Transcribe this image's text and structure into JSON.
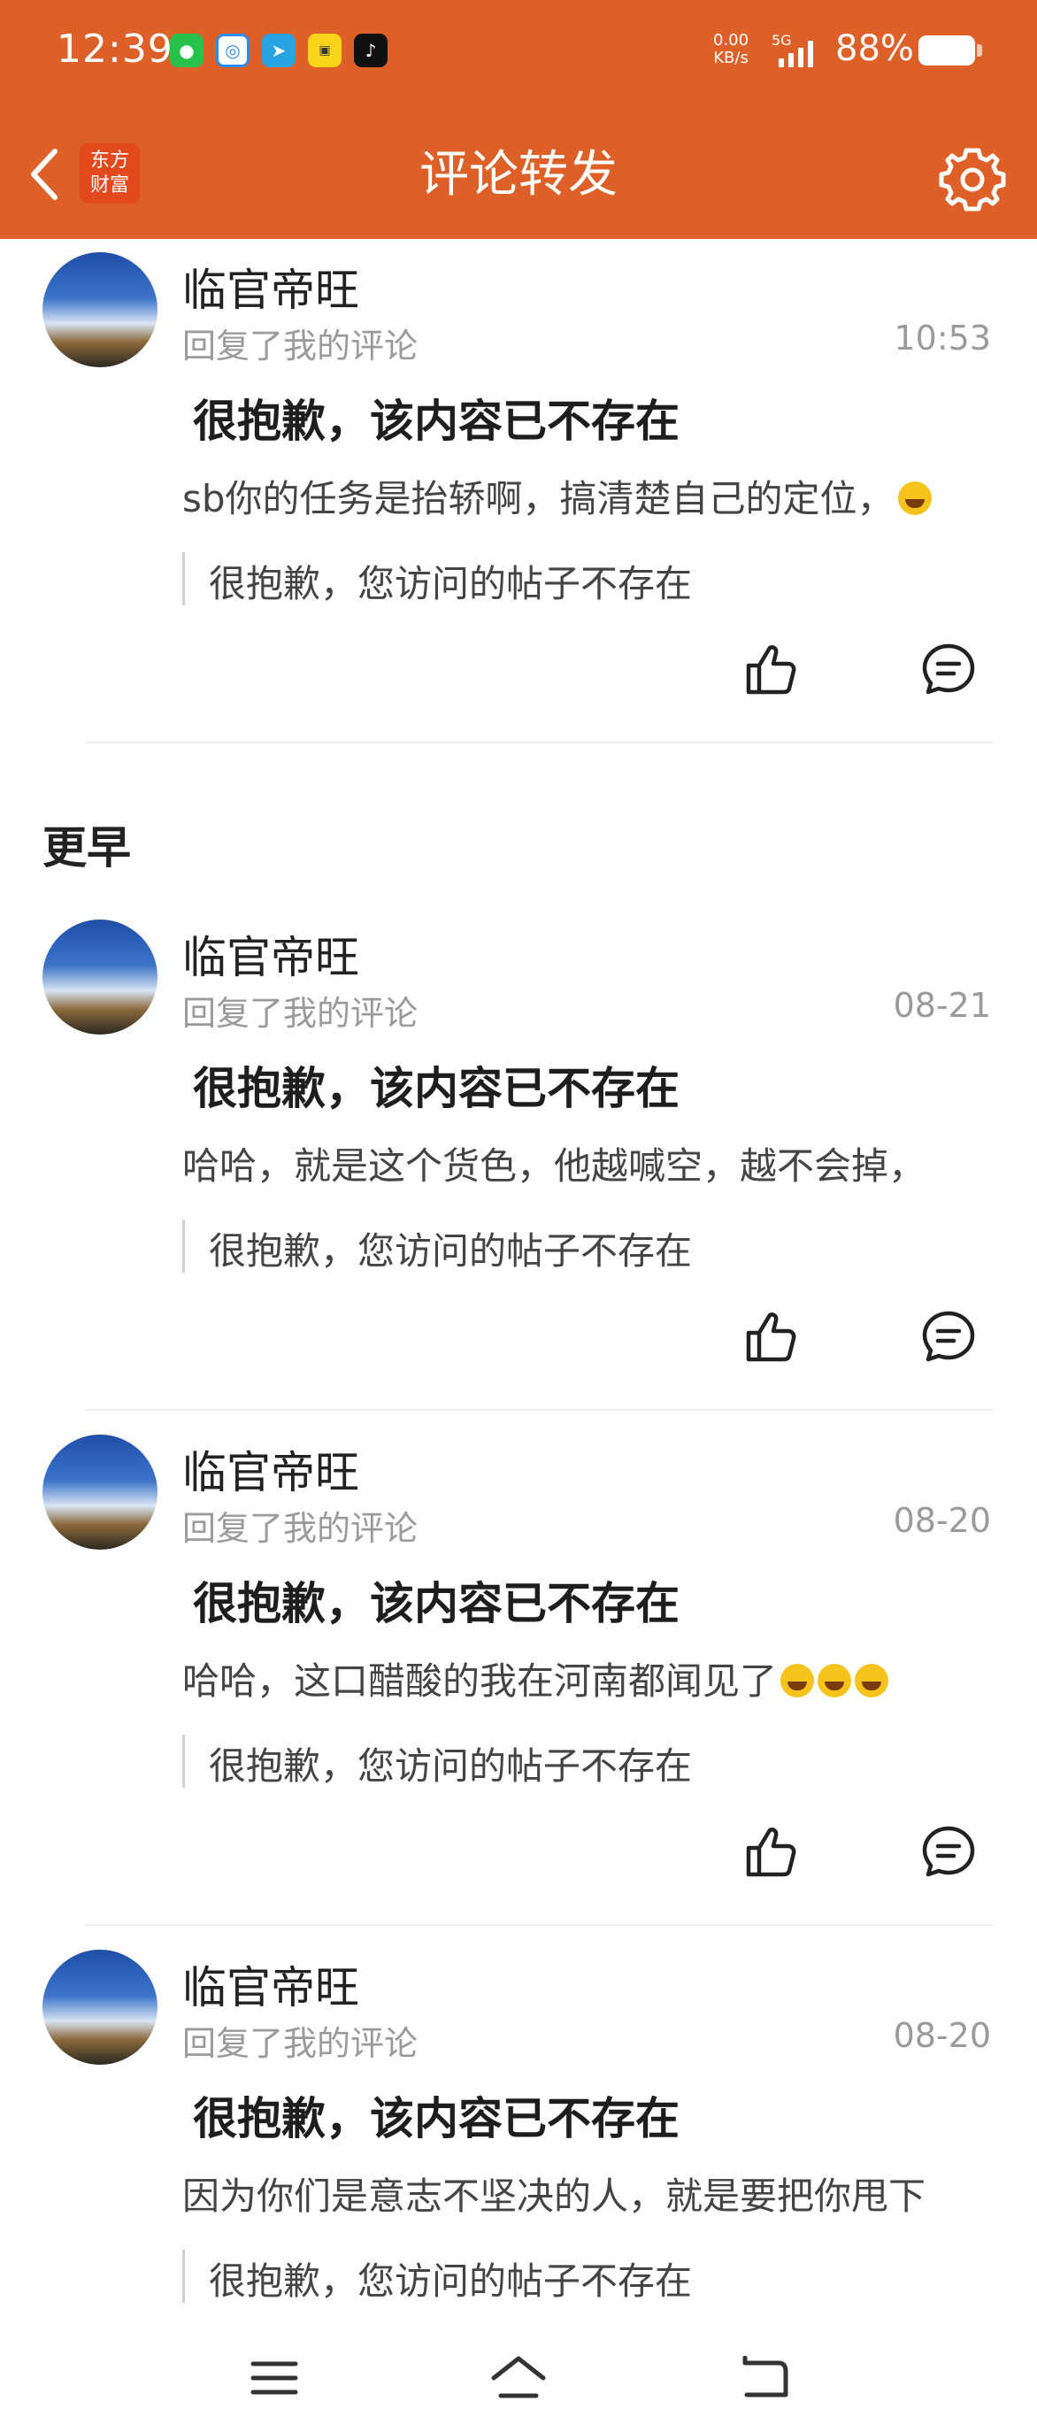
{
  "status_bar": {
    "time": "12:39",
    "net_speed_value": "0.00",
    "net_speed_unit": "KB/s",
    "signal_label": "5G",
    "battery_pct": "88%"
  },
  "header": {
    "title": "评论转发",
    "logo_line1": "东方",
    "logo_line2": "财富",
    "accent_color": "#dd6029"
  },
  "section_earlier": "更早",
  "items": [
    {
      "username": "临官帝旺",
      "subtitle": "回复了我的评论",
      "time": "10:53",
      "title": "很抱歉，该内容已不存在",
      "comment": "sb你的任务是抬轿啊，搞清楚自己的定位，",
      "emoji_count": 1,
      "quote": "很抱歉，您访问的帖子不存在"
    },
    {
      "username": "临官帝旺",
      "subtitle": "回复了我的评论",
      "time": "08-21",
      "title": "很抱歉，该内容已不存在",
      "comment": "哈哈，就是这个货色，他越喊空，越不会掉，",
      "emoji_count": 0,
      "quote": "很抱歉，您访问的帖子不存在"
    },
    {
      "username": "临官帝旺",
      "subtitle": "回复了我的评论",
      "time": "08-20",
      "title": "很抱歉，该内容已不存在",
      "comment": "哈哈，这口醋酸的我在河南都闻见了",
      "emoji_count": 3,
      "quote": "很抱歉，您访问的帖子不存在"
    },
    {
      "username": "临官帝旺",
      "subtitle": "回复了我的评论",
      "time": "08-20",
      "title": "很抱歉，该内容已不存在",
      "comment": "因为你们是意志不坚决的人，就是要把你甩下",
      "emoji_count": 0,
      "quote": "很抱歉，您访问的帖子不存在"
    }
  ],
  "icons": {
    "back": "chevron-left-icon",
    "settings": "gear-icon",
    "like": "thumbs-up-icon",
    "reply": "comment-icon",
    "nav_menu": "menu-icon",
    "nav_home": "home-icon",
    "nav_back": "back-icon"
  }
}
